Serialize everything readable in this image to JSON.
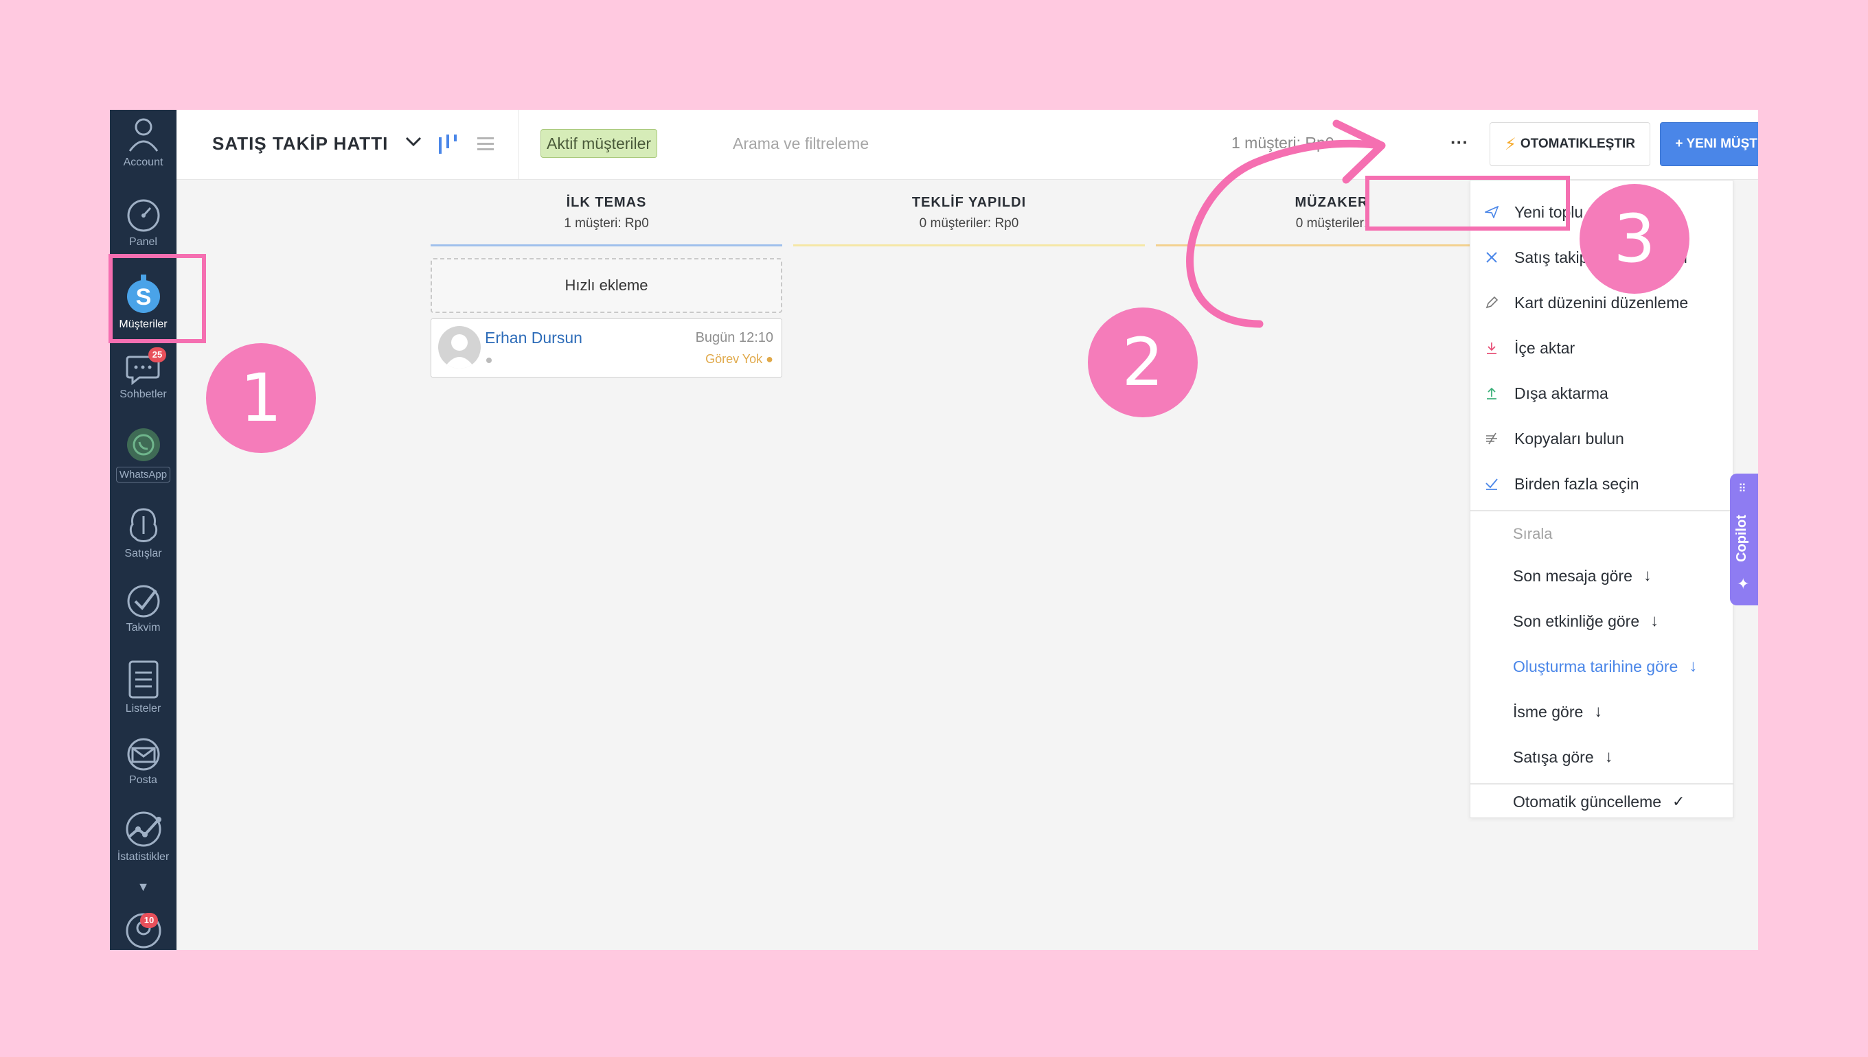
{
  "sidebar": {
    "items": [
      {
        "label": "Account"
      },
      {
        "label": "Panel"
      },
      {
        "label": "Müşteriler"
      },
      {
        "label": "Sohbetler",
        "badge": "25"
      },
      {
        "label": "WhatsApp"
      },
      {
        "label": "Satışlar"
      },
      {
        "label": "Takvim"
      },
      {
        "label": "Listeler"
      },
      {
        "label": "Posta"
      },
      {
        "label": "İstatistikler"
      }
    ],
    "profile_badge": "10"
  },
  "topbar": {
    "pipeline_title": "SATIŞ TAKİP HATTI",
    "filter_tag": "Aktif müşteriler",
    "search_placeholder": "Arama ve filtreleme",
    "summary": "1 müşteri: Rp0",
    "more_label": "···",
    "automate_label": "OTOMATIKLEŞTIR",
    "new_customer_label": "+ YENI MÜŞTERI"
  },
  "columns": [
    {
      "title": "İLK TEMAS",
      "subtitle": "1 müşteri: Rp0",
      "color": "#9fc0ec"
    },
    {
      "title": "TEKLİF YAPILDI",
      "subtitle": "0 müşteriler: Rp0",
      "color": "#f5e7a6"
    },
    {
      "title": "MÜZAKER",
      "subtitle": "0 müşteriler:",
      "color": "#f3d18f"
    }
  ],
  "board": {
    "quick_add": "Hızlı ekleme",
    "card": {
      "name": "Erhan Dursun",
      "date": "Bugün 12:10",
      "task": "Görev Yok"
    }
  },
  "menu": {
    "actions": [
      {
        "label": "Yeni toplu mesaj",
        "icon": "send-icon"
      },
      {
        "label": "Satış takip hattını düzenl",
        "icon": "settings-icon"
      },
      {
        "label": "Kart düzenini düzenleme",
        "icon": "pencil-icon"
      },
      {
        "label": "İçe aktar",
        "icon": "download-icon"
      },
      {
        "label": "Dışa aktarma",
        "icon": "upload-icon"
      },
      {
        "label": "Kopyaları bulun",
        "icon": "duplicate-icon"
      },
      {
        "label": "Birden fazla seçin",
        "icon": "check-icon"
      }
    ],
    "sort_header": "Sırala",
    "sort_options": [
      {
        "label": "Son mesaja göre"
      },
      {
        "label": "Son etkinliğe göre"
      },
      {
        "label": "Oluşturma tarihine göre",
        "active": true
      },
      {
        "label": "İsme göre"
      },
      {
        "label": "Satışa göre"
      }
    ],
    "auto_update": "Otomatik güncelleme"
  },
  "copilot_label": "Copilot",
  "annotations": {
    "step1": "1",
    "step2": "2",
    "step3": "3"
  },
  "colors": {
    "background": "#ffc9e0",
    "accent": "#4a86e8",
    "annotation": "#f56fb1",
    "sidebar": "#1f2f44",
    "copilot": "#8e7cf2"
  }
}
